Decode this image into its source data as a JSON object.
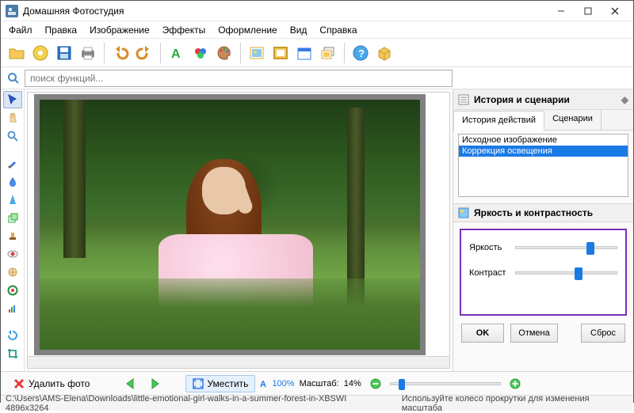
{
  "window": {
    "title": "Домашняя Фотостудия"
  },
  "menu": {
    "items": [
      "Файл",
      "Правка",
      "Изображение",
      "Эффекты",
      "Оформление",
      "Вид",
      "Справка"
    ]
  },
  "search": {
    "placeholder": "поиск функций..."
  },
  "right_panel": {
    "title": "История и сценарии",
    "tabs": {
      "history": "История действий",
      "scenarios": "Сценарии"
    },
    "history_items": [
      "Исходное изображение",
      "Коррекция освещения"
    ],
    "section_title": "Яркость и контрастность",
    "brightness_label": "Яркость",
    "contrast_label": "Контраст",
    "brightness_pct": 74,
    "contrast_pct": 62,
    "ok": "OK",
    "cancel": "Отмена",
    "reset": "Сброс"
  },
  "bottom": {
    "delete_label": "Удалить фото",
    "fit_label": "Уместить",
    "zoom_100": "100%",
    "scale_label": "Масштаб:",
    "scale_value": "14%",
    "zoom_slider_pct": 10
  },
  "status": {
    "path": "C:\\Users\\AMS-Elena\\Downloads\\little-emotional-girl-walks-in-a-summer-forest-in-XBSWI 4896x3264",
    "hint": "Используйте колесо прокрутки для изменения масштаба"
  }
}
